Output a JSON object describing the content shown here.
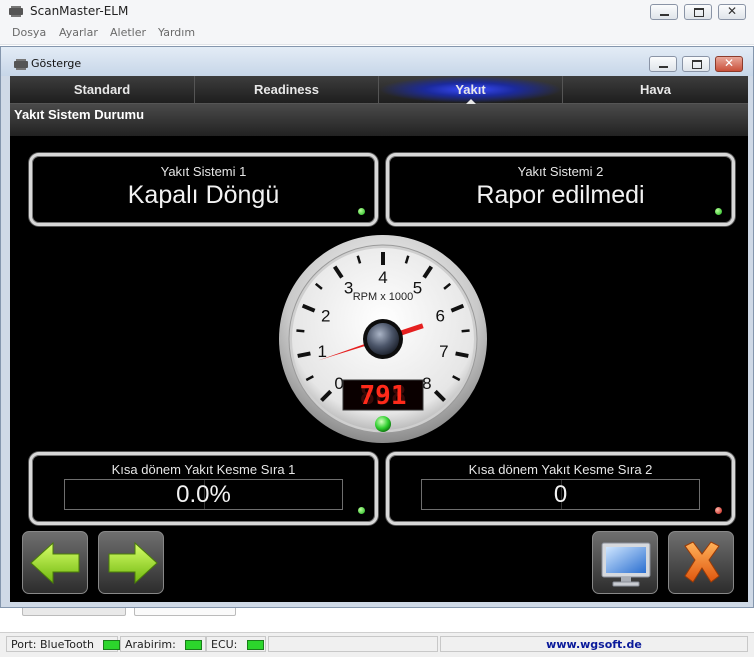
{
  "app": {
    "title": "ScanMaster-ELM",
    "menu": [
      "Dosya",
      "Ayarlar",
      "Aletler",
      "Yardım"
    ]
  },
  "window": {
    "title": "Gösterge",
    "tabs": [
      {
        "label": "Standard",
        "active": false
      },
      {
        "label": "Readiness",
        "active": false
      },
      {
        "label": "Yakıt",
        "active": true
      },
      {
        "label": "Hava",
        "active": false
      }
    ],
    "section_title": "Yakıt Sistem Durumu"
  },
  "fuel_system_1": {
    "label": "Yakıt Sistemi 1",
    "value": "Kapalı Döngü",
    "status": "green"
  },
  "fuel_system_2": {
    "label": "Yakıt Sistemi 2",
    "value": "Rapor edilmedi",
    "status": "green"
  },
  "tachometer": {
    "unit_label": "RPM x 1000",
    "ticks": [
      "0",
      "1",
      "2",
      "3",
      "4",
      "5",
      "6",
      "7",
      "8"
    ],
    "rpm": 791,
    "digital_readout": "791",
    "status": "green"
  },
  "short_term_trim_1": {
    "label": "Kısa dönem Yakıt Kesme Sıra 1",
    "value": "0.0%",
    "status": "green"
  },
  "short_term_trim_2": {
    "label": "Kısa dönem Yakıt Kesme Sıra 2",
    "value": "0",
    "status": "red"
  },
  "buttons": {
    "back": "back-arrow-icon",
    "forward": "forward-arrow-icon",
    "monitor": "monitor-icon",
    "close": "close-x-icon"
  },
  "statusbar": {
    "port_label": "Port:",
    "port_value": "BlueTooth",
    "interface_label": "Arabirim:",
    "ecu_label": "ECU:",
    "website": "www.wgsoft.de"
  },
  "colors": {
    "led_green": "#2cd62c",
    "led_red": "#c01a10",
    "tab_active_glow": "#3a4cff",
    "needle": "#e52020",
    "digital_red": "#ff2a1a",
    "arrow_green": "#9be01e",
    "close_orange": "#f07a1a"
  }
}
